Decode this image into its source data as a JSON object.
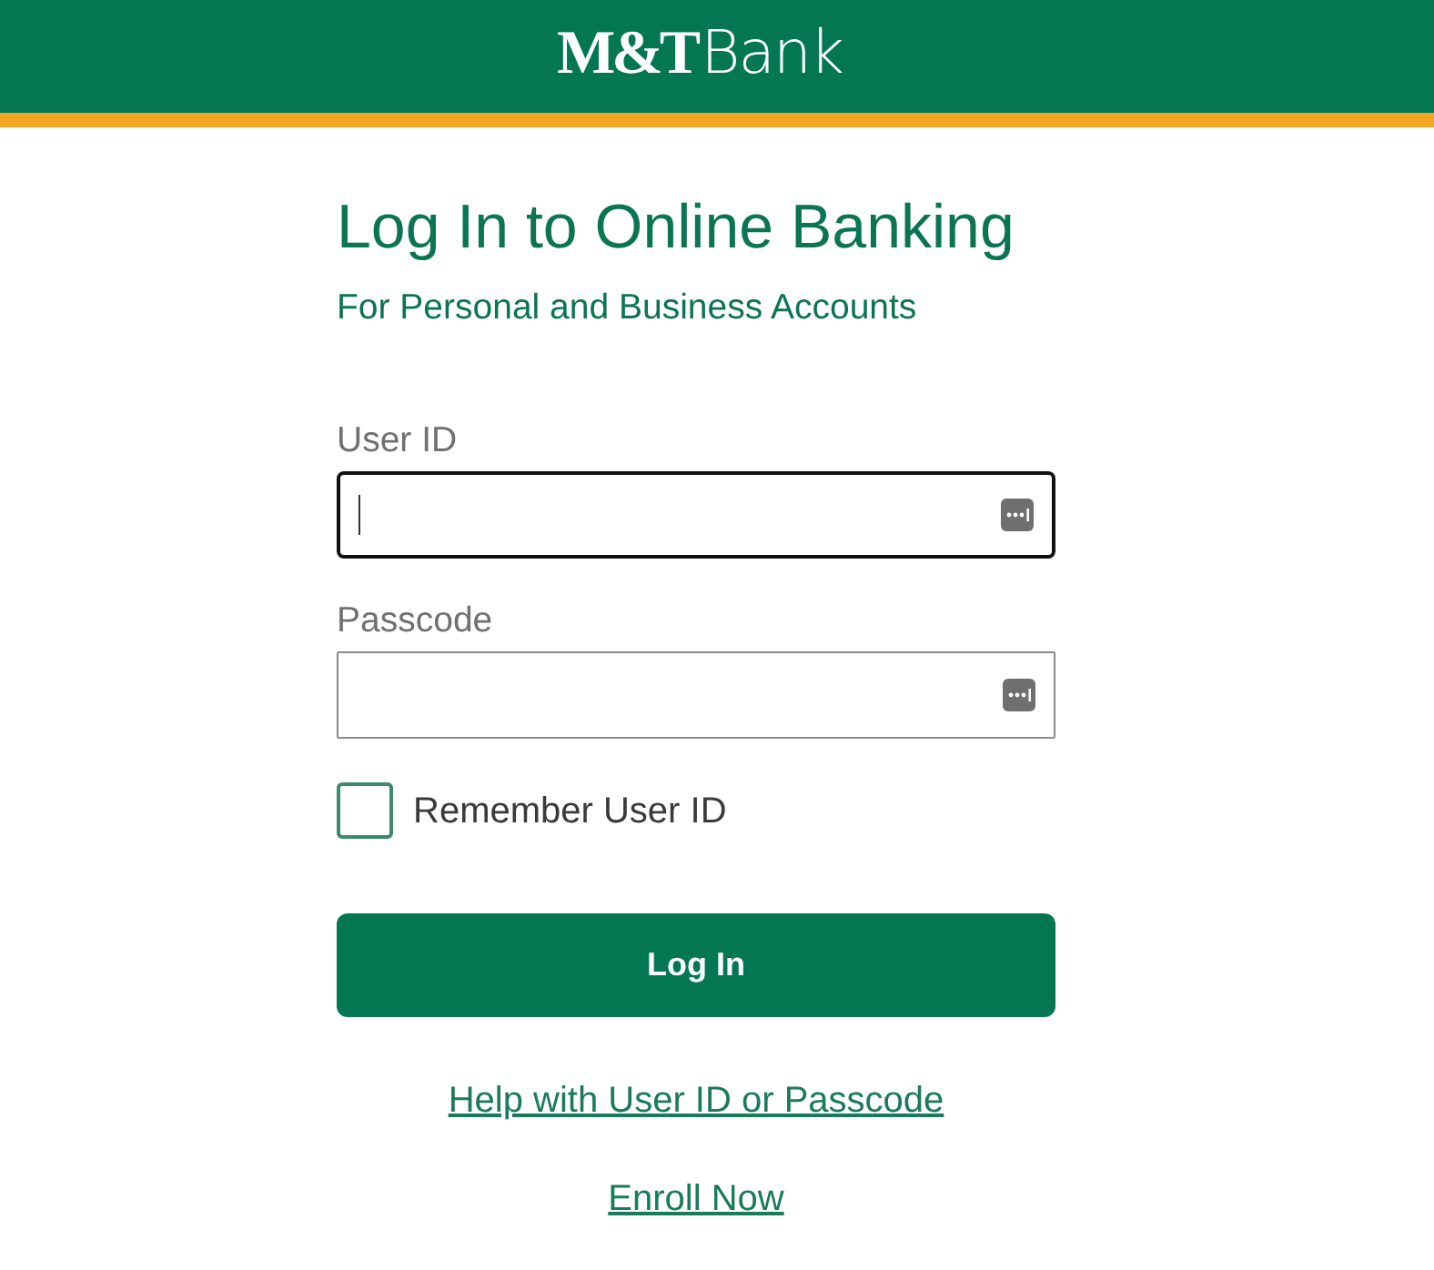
{
  "header": {
    "logo": {
      "mark": "M&T",
      "name": "Bank"
    }
  },
  "login": {
    "title": "Log In to Online Banking",
    "subtitle": "For Personal and Business Accounts",
    "fields": [
      {
        "label": "User ID",
        "focused": true
      },
      {
        "label": "Passcode",
        "focused": false
      }
    ],
    "remember": {
      "label": "Remember User ID",
      "checked": false
    },
    "submit": "Log In",
    "links": [
      "Help with User ID or Passcode",
      "Enroll Now"
    ]
  }
}
